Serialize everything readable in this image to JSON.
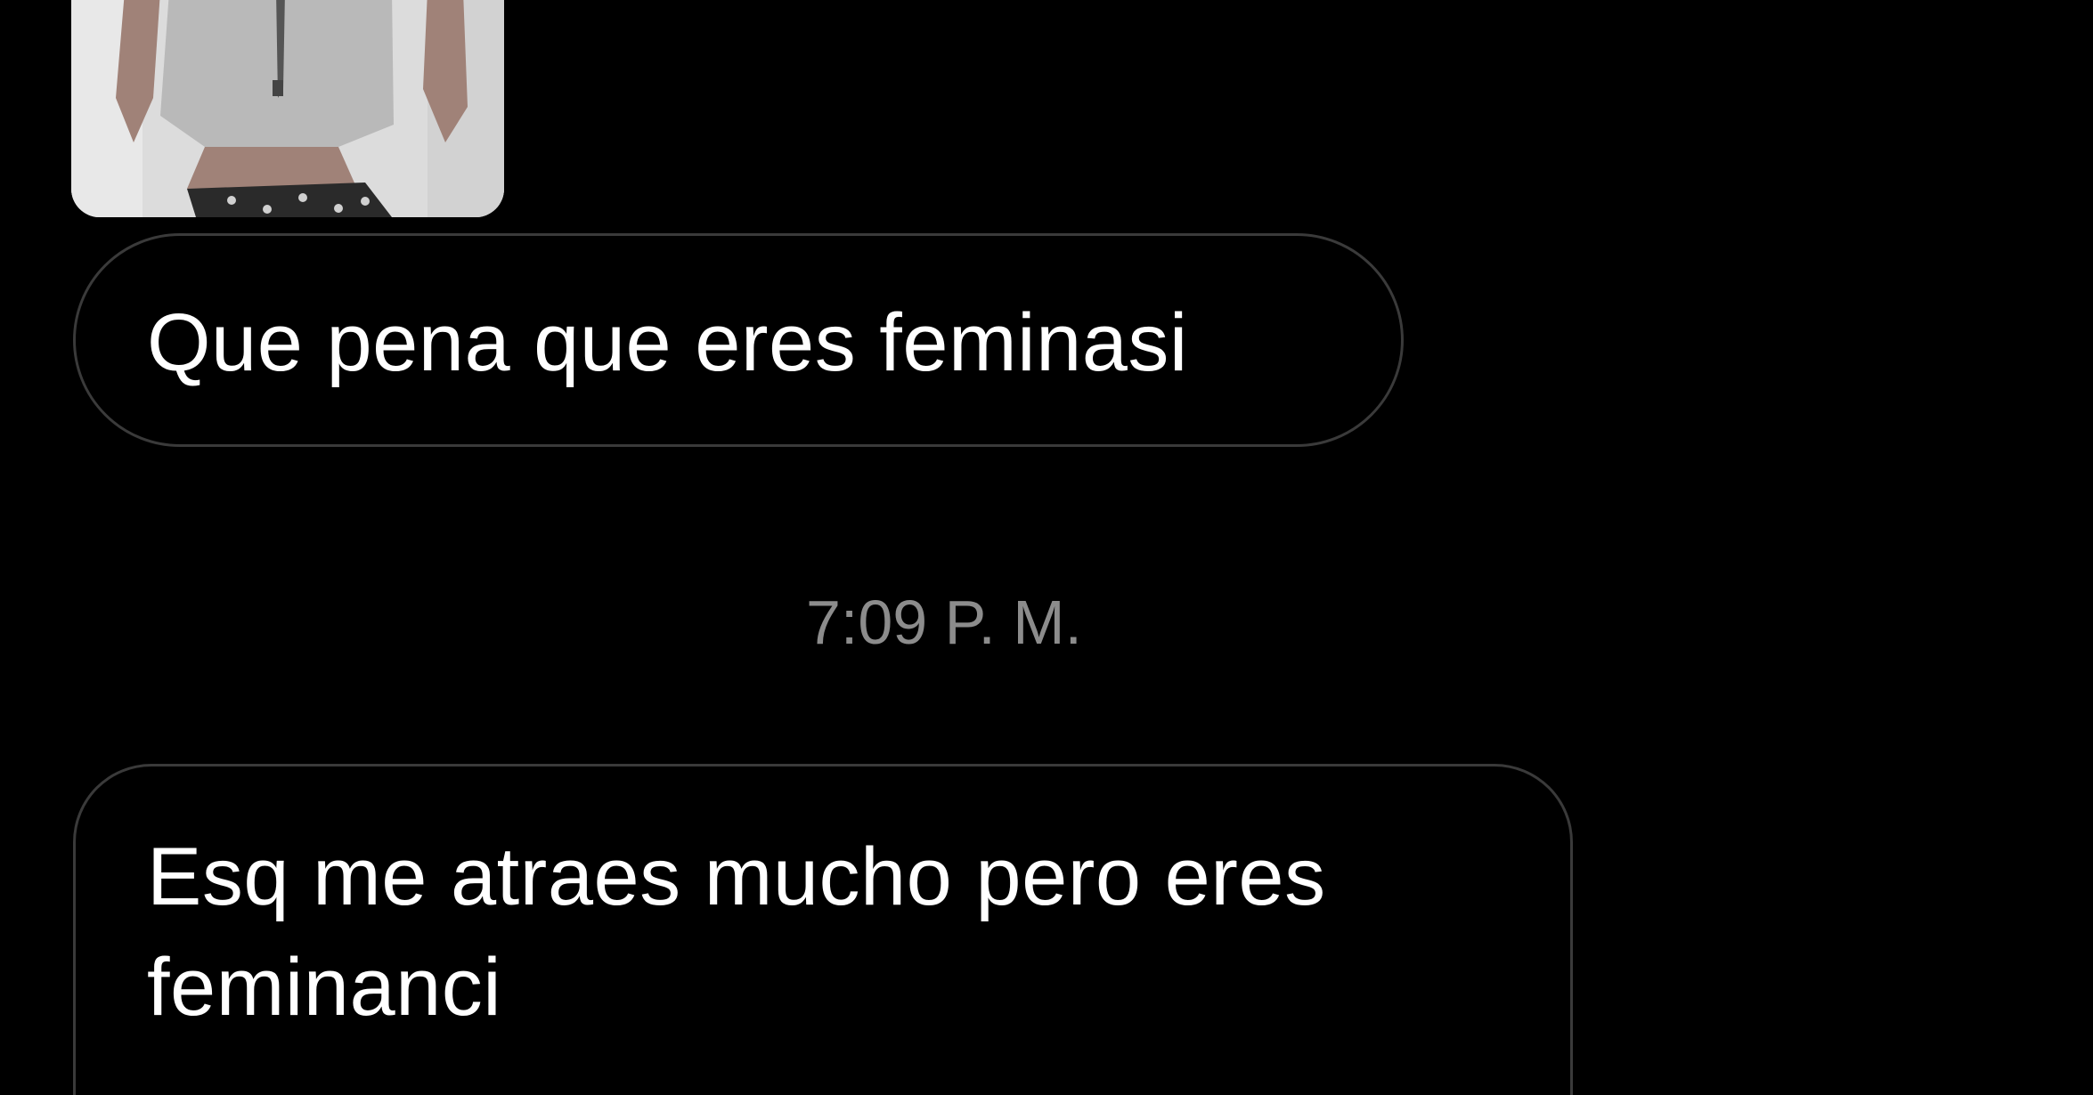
{
  "conversation": {
    "image_message": {
      "name": "photo"
    },
    "messages": [
      {
        "text": "Que pena que eres feminasi"
      },
      {
        "text": "Esq me atraes mucho pero eres feminanci"
      }
    ],
    "timestamp": "7:09 P. M."
  },
  "colors": {
    "background": "#000000",
    "bubble_border": "#3a3a3a",
    "message_text": "#ffffff",
    "timestamp_text": "#8c8c8c"
  }
}
